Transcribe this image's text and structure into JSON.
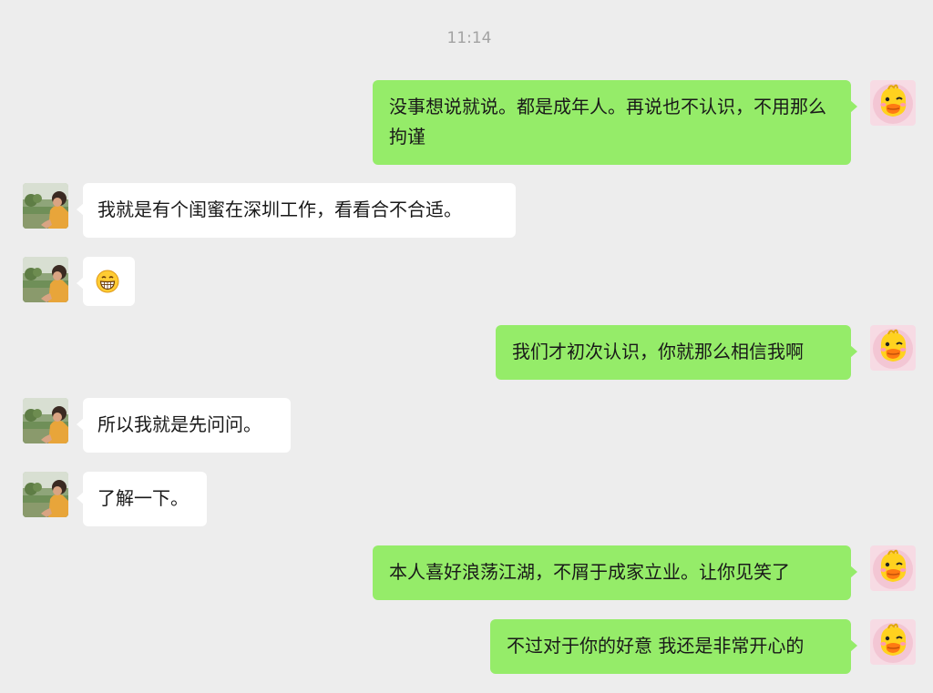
{
  "chat": {
    "timestamp": "11:14",
    "messages": [
      {
        "side": "right",
        "text": "没事想说就说。都是成年人。再说也不认识，不用那么拘谨"
      },
      {
        "side": "left",
        "text": "我就是有个闺蜜在深圳工作，看看合不合适。"
      },
      {
        "side": "left",
        "emoji": "grinning-face-emoji"
      },
      {
        "side": "right",
        "text": "我们才初次认识，你就那么相信我啊"
      },
      {
        "side": "left",
        "text": "所以我就是先问问。"
      },
      {
        "side": "left",
        "text": "了解一下。"
      },
      {
        "side": "right",
        "text": "本人喜好浪荡江湖，不屑于成家立业。让你见笑了"
      },
      {
        "side": "right",
        "text": "不过对于你的好意 我还是非常开心的"
      }
    ]
  },
  "colors": {
    "background": "#ededed",
    "outgoing_bubble": "#95ec69",
    "incoming_bubble": "#ffffff"
  }
}
